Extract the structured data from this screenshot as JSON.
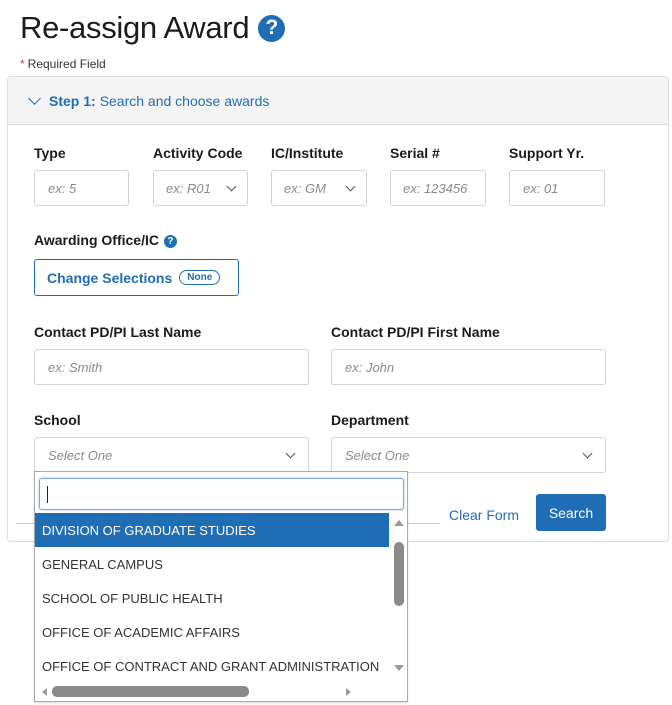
{
  "page": {
    "title": "Re-assign Award",
    "help_glyph": "?",
    "required_star": "*",
    "required_label": "Required Field"
  },
  "step": {
    "prefix": "Step 1:",
    "label": "Search and choose awards",
    "icon": "chevron-down-icon"
  },
  "fields": {
    "type": {
      "label": "Type",
      "placeholder": "ex: 5"
    },
    "activity_code": {
      "label": "Activity Code",
      "placeholder": "ex: R01"
    },
    "ic_institute": {
      "label": "IC/Institute",
      "placeholder": "ex: GM"
    },
    "serial": {
      "label": "Serial #",
      "placeholder": "ex: 123456"
    },
    "support_yr": {
      "label": "Support Yr.",
      "placeholder": "ex: 01"
    },
    "awarding_office": {
      "label": "Awarding Office/IC",
      "help_glyph": "?",
      "button_label": "Change Selections",
      "selection_badge": "None"
    },
    "last_name": {
      "label": "Contact PD/PI Last Name",
      "placeholder": "ex: Smith"
    },
    "first_name": {
      "label": "Contact PD/PI First Name",
      "placeholder": "ex: John"
    },
    "school": {
      "label": "School",
      "placeholder": "Select One"
    },
    "department": {
      "label": "Department",
      "placeholder": "Select One"
    }
  },
  "actions": {
    "clear_label": "Clear Form",
    "search_label": "Search"
  },
  "school_dropdown": {
    "search_value": "",
    "options": [
      {
        "label": "DIVISION OF GRADUATE STUDIES",
        "highlighted": true
      },
      {
        "label": "GENERAL CAMPUS",
        "highlighted": false
      },
      {
        "label": "SCHOOL OF PUBLIC HEALTH",
        "highlighted": false
      },
      {
        "label": "OFFICE OF ACADEMIC AFFAIRS",
        "highlighted": false
      },
      {
        "label": "OFFICE OF CONTRACT AND GRANT ADMINISTRATION",
        "highlighted": false
      }
    ]
  },
  "colors": {
    "accent": "#1f6eb5",
    "required": "#d83a3a",
    "panel_header_bg": "#f4f4f4"
  }
}
